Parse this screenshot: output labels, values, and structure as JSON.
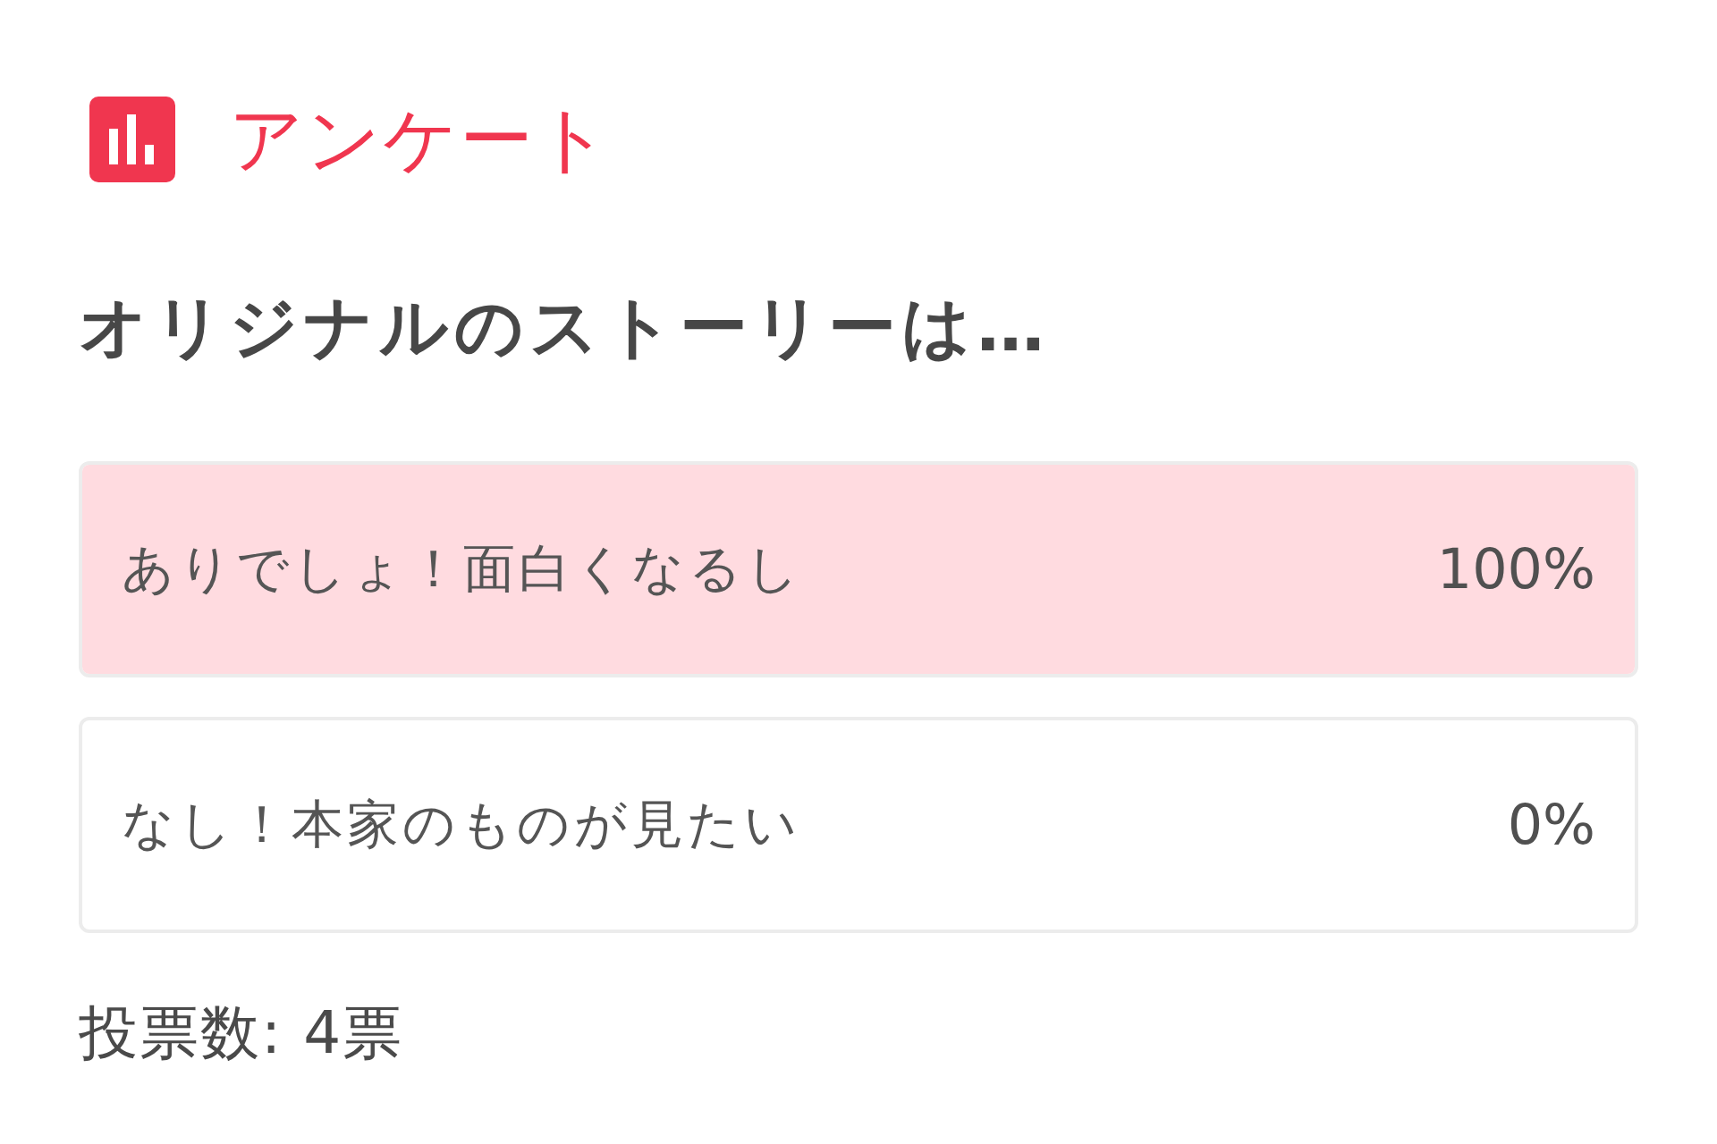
{
  "header": {
    "title": "アンケート"
  },
  "question": "オリジナルのストーリーは…",
  "options": [
    {
      "label": "ありでしょ！面白くなるし",
      "percent": "100%",
      "level": 1
    },
    {
      "label": "なし！本家のものが見たい",
      "percent": "0%"
    }
  ],
  "total_votes": "投票数: 4票"
}
